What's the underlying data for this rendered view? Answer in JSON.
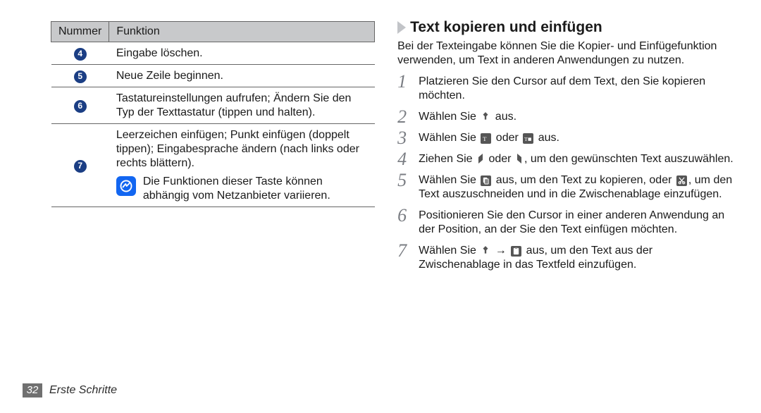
{
  "table": {
    "headers": [
      "Nummer",
      "Funktion"
    ],
    "rows": [
      {
        "num": "4",
        "text": "Eingabe löschen."
      },
      {
        "num": "5",
        "text": "Neue Zeile beginnen."
      },
      {
        "num": "6",
        "text": "Tastatureinstellungen aufrufen; Ändern Sie den Typ der Texttastatur (tippen und halten)."
      },
      {
        "num": "7",
        "text": "Leerzeichen einfügen; Punkt einfügen (doppelt tippen); Eingabesprache ändern (nach links oder rechts blättern).",
        "note": "Die Funktionen dieser Taste können abhängig vom Netzanbieter variieren."
      }
    ]
  },
  "heading": "Text kopieren und einfügen",
  "intro": "Bei der Texteingabe können Sie die Kopier- und Einfügefunktion verwenden, um Text in anderen Anwendungen zu nutzen.",
  "steps": {
    "s1": "Platzieren Sie den Cursor auf dem Text, den Sie kopieren möchten.",
    "s2a": "Wählen Sie ",
    "s2b": " aus.",
    "s3a": "Wählen Sie ",
    "s3b": " oder ",
    "s3c": " aus.",
    "s4a": "Ziehen Sie ",
    "s4b": " oder ",
    "s4c": ", um den gewünschten Text auszuwählen.",
    "s5a": "Wählen Sie ",
    "s5b": " aus, um den Text zu kopieren, oder ",
    "s5c": ", um den Text auszuschneiden und in die Zwischenablage einzufügen.",
    "s6": "Positionieren Sie den Cursor in einer anderen Anwendung an der Position, an der Sie den Text einfügen möchten.",
    "s7a": "Wählen Sie ",
    "s7b": " → ",
    "s7c": " aus, um den Text aus der Zwischenablage in das Textfeld einzufügen."
  },
  "footer": {
    "page": "32",
    "section": "Erste Schritte"
  }
}
